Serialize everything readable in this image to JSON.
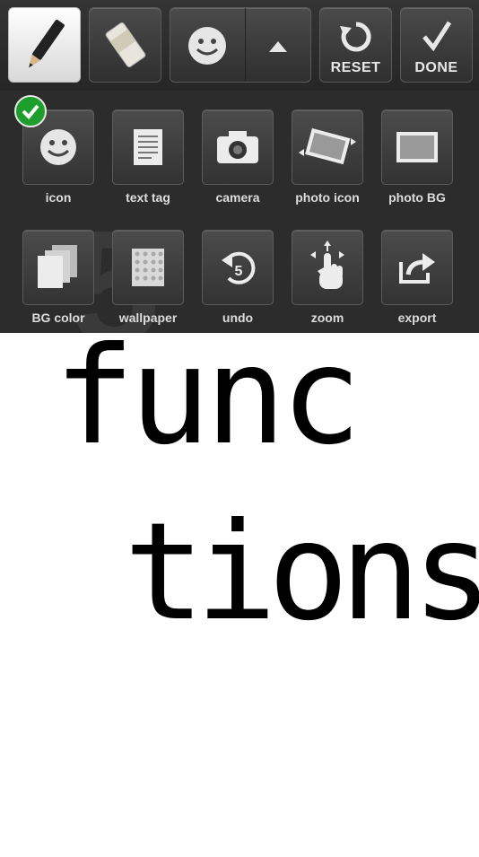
{
  "toolbar": {
    "reset_label": "RESET",
    "done_label": "DONE"
  },
  "grid": {
    "items": [
      {
        "label": "icon",
        "icon": "smiley-icon"
      },
      {
        "label": "text tag",
        "icon": "document-icon"
      },
      {
        "label": "camera",
        "icon": "camera-icon"
      },
      {
        "label": "photo icon",
        "icon": "rotate-photo-icon"
      },
      {
        "label": "photo BG",
        "icon": "photo-frame-icon"
      },
      {
        "label": "BG color",
        "icon": "stacked-pages-icon"
      },
      {
        "label": "wallpaper",
        "icon": "pattern-icon"
      },
      {
        "label": "undo",
        "icon": "undo-icon"
      },
      {
        "label": "zoom",
        "icon": "hand-gesture-icon"
      },
      {
        "label": "export",
        "icon": "share-icon"
      }
    ],
    "background_number": "5",
    "undo_count": "5"
  },
  "colors": {
    "check": "#1e9e2c",
    "panel": "#2a2a2a"
  },
  "canvas": {
    "line1": "func",
    "line2": "tions"
  }
}
